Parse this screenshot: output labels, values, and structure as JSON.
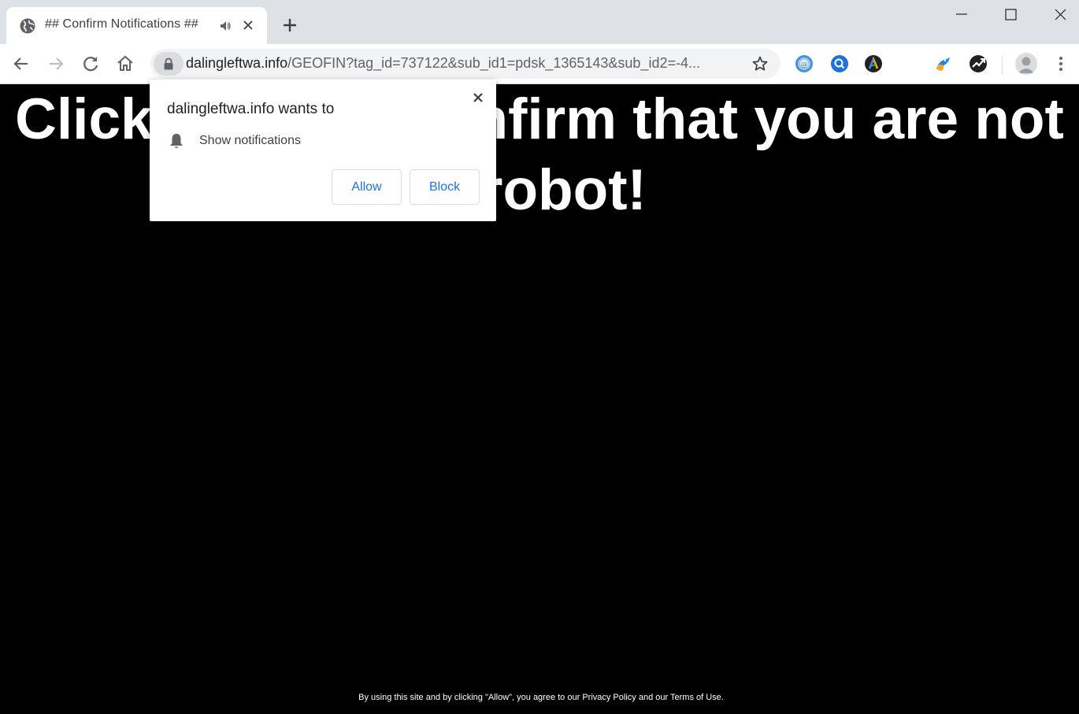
{
  "tab": {
    "title": "## Confirm Notifications ##"
  },
  "omnibox": {
    "host": "dalingleftwa.info",
    "path": "/GEOFIN?tag_id=737122&sub_id1=pdsk_1365143&sub_id2=-4..."
  },
  "page": {
    "headline": "Click Allow to confirm that you are not a robot!",
    "footer": "By using this site and by clicking \"Allow\", you agree to our Privacy Policy and our Terms of Use."
  },
  "popup": {
    "title": "dalingleftwa.info wants to",
    "permission": "Show notifications",
    "allow_label": "Allow",
    "block_label": "Block"
  },
  "colors": {
    "accent": "#1a73e8",
    "page_background": "#000000",
    "headline": "#ffffff",
    "tabstrip": "#dee1e6"
  },
  "icons": [
    "globe-icon",
    "audio-icon",
    "close-icon",
    "plus-icon",
    "back-icon",
    "forward-icon",
    "reload-icon",
    "home-icon",
    "lock-icon",
    "star-icon",
    "bell-icon",
    "more-vert-icon"
  ]
}
